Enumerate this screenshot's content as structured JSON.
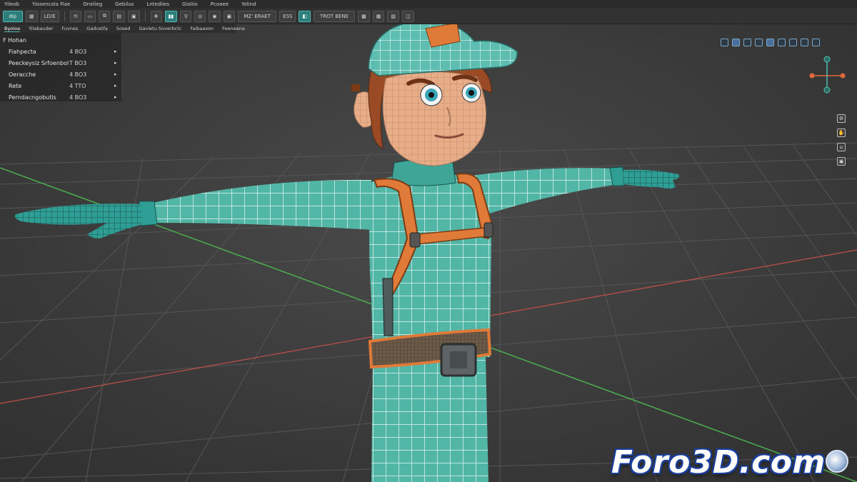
{
  "menu": [
    "Yileob",
    "Yiosencola Fiae",
    "Onelieg",
    "Gebilus",
    "Lntediies",
    "Gioliio",
    "Pcoaee",
    "Yolind"
  ],
  "toolbar": {
    "items": [
      {
        "label": "d◎",
        "active": true
      },
      {
        "label": "▦"
      },
      {
        "label": "LD/E"
      },
      {
        "label": "⟲"
      },
      {
        "label": "▭"
      },
      {
        "label": "⧉"
      },
      {
        "label": "▤"
      },
      {
        "label": "▣"
      },
      {
        "label": "✥"
      },
      {
        "label": "▮▮",
        "active": true
      },
      {
        "label": "⚲"
      },
      {
        "label": "◎"
      },
      {
        "label": "◉"
      },
      {
        "label": "▣"
      },
      {
        "label": "MZ' ERAET"
      },
      {
        "label": "ESS"
      },
      {
        "label": "◧",
        "active": true
      },
      {
        "label": "TROT  BENE"
      },
      {
        "label": "▩"
      },
      {
        "label": "▦"
      },
      {
        "label": "▧"
      },
      {
        "label": "◫"
      }
    ]
  },
  "tabs": [
    "Byoioa",
    "Yilabauder",
    "Fuvnes",
    "Gadcetfa",
    "Sosed",
    "Gavletu Soverbctc",
    "Faibaaxon",
    "Feeneana"
  ],
  "outliner": {
    "rows": [
      {
        "name": "F Hohan",
        "value": "",
        "arrow": ""
      },
      {
        "name": "Fiahpecta",
        "value": "4 BO3",
        "arrow": "▸"
      },
      {
        "name": "Peeckeysiz Srfoenbol",
        "value": "T BO3",
        "arrow": "▸"
      },
      {
        "name": "Oeracche",
        "value": "4 BO3",
        "arrow": "▸"
      },
      {
        "name": "Rete",
        "value": "4 TTO",
        "arrow": "▸"
      },
      {
        "name": "Perndacngobutls",
        "value": "4 BO3",
        "arrow": "▸"
      }
    ]
  },
  "side_tools": [
    "⚙",
    "✋",
    "⌂",
    "▣"
  ],
  "watermark": {
    "text": "Foro3D.com"
  },
  "colors": {
    "accent_teal": "#48b8b2",
    "suit_teal": "#4fb5a6",
    "strap_orange": "#e07a38",
    "hair_brown": "#9a4a24",
    "skin": "#e8b08c",
    "grid_line": "#505050",
    "axis_green": "#4caf50",
    "axis_red": "#c0504a"
  }
}
